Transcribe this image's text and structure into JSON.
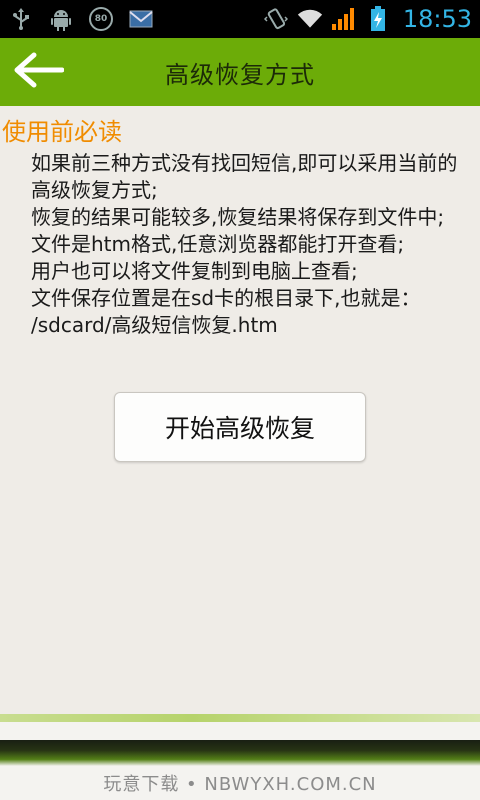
{
  "status_bar": {
    "time": "18:53",
    "badge": "80",
    "icons": [
      "usb-icon",
      "android-debug-icon",
      "badge-80-icon",
      "email-icon",
      "vibrate-icon",
      "wifi-icon",
      "signal-icon",
      "battery-charging-icon"
    ],
    "accent_color": "#33b5e5"
  },
  "header": {
    "title": "高级恢复方式",
    "back_icon": "arrow-left-icon",
    "bar_color": "#6cac08"
  },
  "main": {
    "heading": "使用前必读",
    "heading_color": "#f08c00",
    "lines": [
      "如果前三种方式没有找回短信,即可以采用当前的高级恢复方式;",
      "恢复的结果可能较多,恢复结果将保存到文件中;",
      "文件是htm格式,任意浏览器都能打开查看;",
      "用户也可以将文件复制到电脑上查看;",
      "文件保存位置是在sd卡的根目录下,也就是：",
      "/sdcard/高级短信恢复.htm"
    ],
    "start_button_label": "开始高级恢复"
  },
  "footer": {
    "watermark": "玩意下载 • NBWYXH.COM.CN"
  }
}
